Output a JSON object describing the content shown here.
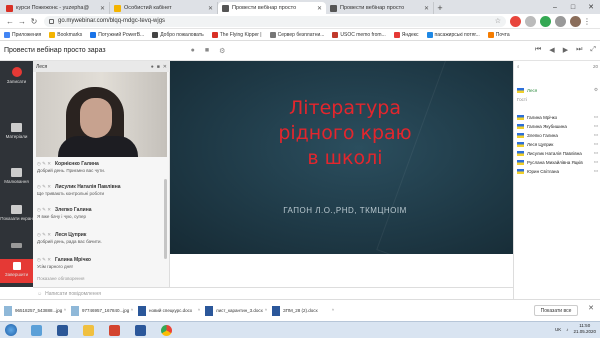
{
  "browser": {
    "tabs": [
      {
        "title": "курси Пожежонє - yuzepha@",
        "fav": "#d93025",
        "active": false
      },
      {
        "title": "Особистий кабінет",
        "fav": "#f4b400",
        "active": false
      },
      {
        "title": "Провести вебінар просто",
        "fav": "#6b6b6b",
        "active": true
      },
      {
        "title": "Провести вебінар просто",
        "fav": "#6b6b6b",
        "active": false
      }
    ],
    "new_tab": "+",
    "url": "go.mywebinar.com/blqq-mdgc-tevq-wjgs",
    "bookmarks": [
      "Приложения",
      "Bookmarks",
      "Потужний PowerB...",
      "Добро пожаловать",
      "The Flying Kipper |",
      "Сервер безплатни...",
      "USOC memo from...",
      "Яндекс",
      "пасажирські потяг...",
      "Почта"
    ]
  },
  "app": {
    "title": "Провести вебінар просто зараз",
    "sidebar": [
      "Записати",
      "Матеріали",
      "Малювання",
      "Показати екран",
      "",
      "Завершити"
    ],
    "camera_name": "Леся",
    "messages": [
      {
        "name": "Корнієнко Галина",
        "text": "Добрий день. Приємно вас чути."
      },
      {
        "name": "Лисулик Наталія Павлівна",
        "text": "Ще тривають контрольні роботи"
      },
      {
        "name": "Злепко Галина",
        "text": "Я вже бачу і чую, супер"
      },
      {
        "name": "Леся Цуприк",
        "text": "Добрий день, рада вас бачити."
      },
      {
        "name": "Галина Мрічко",
        "text": "Усім гарного дня!"
      }
    ],
    "pinned": "Показане обговорення",
    "composer_placeholder": "Написати повідомлення",
    "slide_title_lines": [
      "Література",
      "рідного краю",
      "в школі"
    ],
    "slide_author": "ГАПОН Л.О.,PHD, ТКМЦНОІМ",
    "participants_count": "20",
    "host_label": "Леся",
    "guests_label": "Гості",
    "participants": [
      "Галина Мрічко",
      "Галина Якубишина",
      "Злепко Галина",
      "Леся Цуприк",
      "Лисулик Наталія Павлівна",
      "Руслана Михайлівна Яцків",
      "Юрин Світлана"
    ]
  },
  "downloads": [
    "96518257_543888...jpg",
    "97746957_167840...jpg",
    "новий спецкурс.docx",
    "лист_карантин_3.docx",
    "ЗПМ_28 (2).docx"
  ],
  "show_all": "Показати все",
  "taskbar": {
    "lang": "UK",
    "time": "11:50",
    "date": "21.05.2020"
  }
}
